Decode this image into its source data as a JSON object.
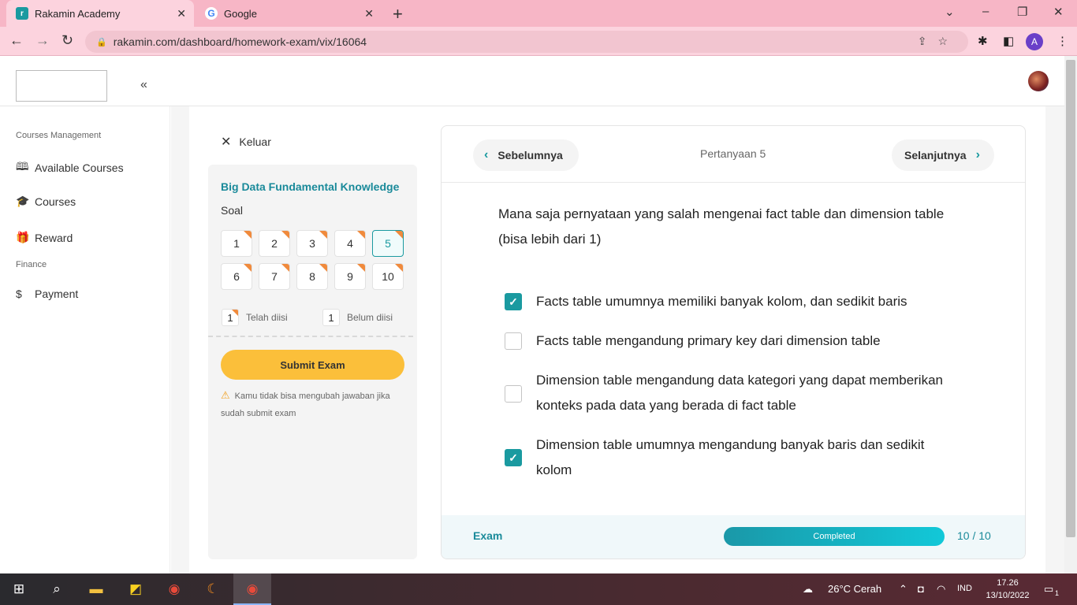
{
  "browser": {
    "tabs": [
      {
        "label": "Rakamin Academy",
        "favicon": "rakamin-logo"
      },
      {
        "label": "Google",
        "favicon": "google-logo"
      }
    ],
    "url": "rakamin.com/dashboard/homework-exam/vix/16064",
    "profile_initial": "A"
  },
  "sidebar": {
    "sections": [
      {
        "title": "Courses Management",
        "items": [
          {
            "label": "Available Courses",
            "icon": "book-icon"
          },
          {
            "label": "Courses",
            "icon": "graduation-cap-icon"
          },
          {
            "label": "Reward",
            "icon": "gift-icon"
          }
        ]
      },
      {
        "title": "Finance",
        "items": [
          {
            "label": "Payment",
            "icon": "dollar-icon"
          }
        ]
      }
    ]
  },
  "exam_panel": {
    "exit_label": "Keluar",
    "course_title": "Big Data Fundamental Knowledge",
    "soal_label": "Soal",
    "questions": [
      "1",
      "2",
      "3",
      "4",
      "5",
      "6",
      "7",
      "8",
      "9",
      "10"
    ],
    "current_question": "5",
    "legend": {
      "filled_count": "1",
      "filled_label": "Telah diisi",
      "empty_count": "1",
      "empty_label": "Belum diisi"
    },
    "submit_label": "Submit Exam",
    "warning": "Kamu tidak bisa mengubah jawaban jika sudah submit exam"
  },
  "question_card": {
    "prev_label": "Sebelumnya",
    "next_label": "Selanjutnya",
    "question_number": "Pertanyaan 5",
    "question_text": "Mana saja pernyataan yang salah mengenai fact table dan dimension table (bisa lebih dari 1)",
    "options": [
      {
        "text": "Facts table umumnya memiliki banyak kolom, dan sedikit baris",
        "checked": true
      },
      {
        "text": "Facts table mengandung primary key dari dimension table",
        "checked": false
      },
      {
        "text": "Dimension table mengandung data kategori yang dapat memberikan konteks pada data yang berada di fact table",
        "checked": false
      },
      {
        "text": "Dimension table umumnya mengandung banyak baris dan sedikit kolom",
        "checked": true
      }
    ],
    "footer": {
      "exam_label": "Exam",
      "progress_label": "Completed",
      "progress_fraction": 1.0,
      "count": "10 / 10"
    }
  },
  "taskbar": {
    "weather": "26°C  Cerah",
    "language": "IND",
    "time": "17.26",
    "date": "13/10/2022",
    "notification_count": "1"
  },
  "colors": {
    "accent_teal": "#1a9aa0",
    "submit_yellow": "#fbbf3a",
    "badge_orange": "#f08a3c",
    "browser_pink": "#fcd3de"
  }
}
